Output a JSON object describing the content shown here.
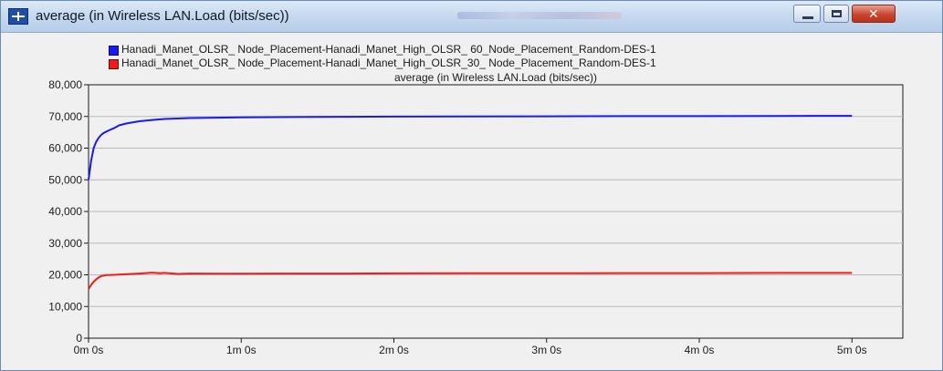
{
  "window": {
    "title": "average (in Wireless LAN.Load (bits/sec))",
    "icon": "app-icon",
    "buttons": [
      "minimize",
      "maximize",
      "close"
    ],
    "close_glyph": "✕"
  },
  "colors": {
    "series_1": "#1a1af0",
    "series_2": "#ee1c1c",
    "plot_background": "#f0f0f0"
  },
  "chart_data": {
    "type": "line",
    "title": "average (in Wireless LAN.Load (bits/sec))",
    "xlabel": "",
    "ylabel": "",
    "ylim": [
      0,
      80000
    ],
    "xlim": [
      0,
      320
    ],
    "x_unit": "seconds",
    "yticks": [
      0,
      10000,
      20000,
      30000,
      40000,
      50000,
      60000,
      70000,
      80000
    ],
    "ytick_labels": [
      "0",
      "10,000",
      "20,000",
      "30,000",
      "40,000",
      "50,000",
      "60,000",
      "70,000",
      "80,000"
    ],
    "xticks": [
      0,
      60,
      120,
      180,
      240,
      300
    ],
    "xtick_labels": [
      "0m 0s",
      "1m 0s",
      "2m 0s",
      "3m 0s",
      "4m 0s",
      "5m 0s"
    ],
    "grid": true,
    "legend_position": "top",
    "series": [
      {
        "name": "Hanadi_Manet_OLSR_ Node_Placement-Hanadi_Manet_High_OLSR_ 60_Node_Placement_Random-DES-1",
        "color": "#1a1af0",
        "x": [
          0,
          1,
          2,
          3,
          4,
          5,
          6,
          8,
          10,
          12,
          15,
          20,
          25,
          30,
          40,
          50,
          60,
          80,
          100,
          120,
          150,
          180,
          210,
          240,
          270,
          300
        ],
        "y": [
          50000,
          56000,
          60000,
          62000,
          63300,
          64200,
          64800,
          65600,
          66300,
          67200,
          67800,
          68500,
          68900,
          69200,
          69500,
          69600,
          69700,
          69800,
          69900,
          69950,
          70000,
          70050,
          70100,
          70100,
          70150,
          70200
        ]
      },
      {
        "name": "Hanadi_Manet_OLSR_ Node_Placement-Hanadi_Manet_High_OLSR_30_ Node_Placement_Random-DES-1",
        "color": "#ee1c1c",
        "x": [
          0,
          1,
          2,
          3,
          4,
          5,
          7,
          10,
          15,
          20,
          25,
          28,
          30,
          35,
          40,
          50,
          60,
          80,
          100,
          120,
          150,
          180,
          210,
          240,
          270,
          300
        ],
        "y": [
          15500,
          16800,
          17800,
          18600,
          19200,
          19600,
          19900,
          20000,
          20200,
          20400,
          20700,
          20500,
          20600,
          20300,
          20400,
          20350,
          20350,
          20400,
          20400,
          20450,
          20500,
          20500,
          20550,
          20550,
          20600,
          20600
        ]
      }
    ]
  }
}
